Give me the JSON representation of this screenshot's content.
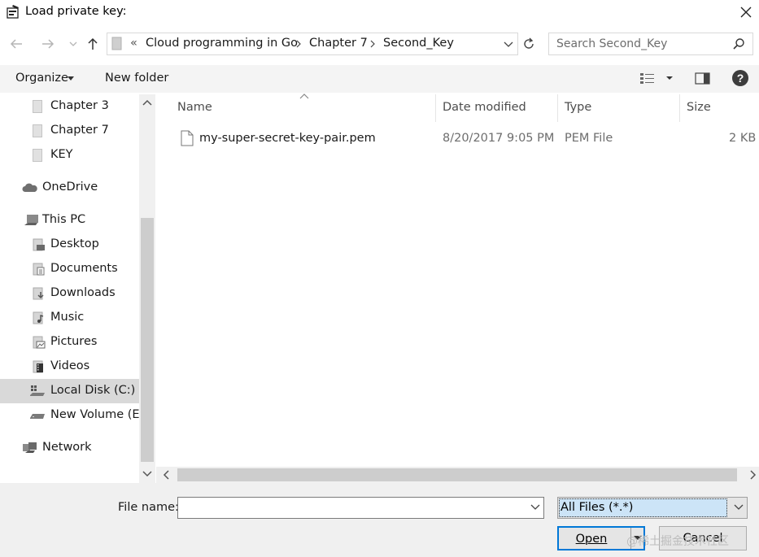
{
  "window": {
    "title": "Load private key:"
  },
  "address_bar": {
    "overflow": "«",
    "crumbs": [
      "Cloud programming in Go",
      "Chapter 7",
      "Second_Key"
    ]
  },
  "search": {
    "placeholder": "Search Second_Key"
  },
  "toolbar": {
    "organize": "Organize",
    "new_folder": "New folder"
  },
  "nav": {
    "items": [
      {
        "label": "Chapter 3",
        "icon": "folder-icon"
      },
      {
        "label": "Chapter 7",
        "icon": "folder-icon"
      },
      {
        "label": "KEY",
        "icon": "folder-icon"
      },
      {
        "label": "OneDrive",
        "icon": "cloud-icon"
      },
      {
        "label": "This PC",
        "icon": "computer-icon"
      },
      {
        "label": "Desktop",
        "icon": "desktop-icon"
      },
      {
        "label": "Documents",
        "icon": "documents-icon"
      },
      {
        "label": "Downloads",
        "icon": "downloads-icon"
      },
      {
        "label": "Music",
        "icon": "music-icon"
      },
      {
        "label": "Pictures",
        "icon": "pictures-icon"
      },
      {
        "label": "Videos",
        "icon": "videos-icon"
      },
      {
        "label": "Local Disk (C:)",
        "icon": "local-disk-icon",
        "selected": true
      },
      {
        "label": "New Volume (E:)",
        "icon": "drive-icon"
      },
      {
        "label": "Network",
        "icon": "network-icon"
      }
    ]
  },
  "columns": [
    "Name",
    "Date modified",
    "Type",
    "Size"
  ],
  "files": [
    {
      "name": "my-super-secret-key-pair.pem",
      "date": "8/20/2017 9:05 PM",
      "type": "PEM File",
      "size": "2 KB"
    }
  ],
  "bottom": {
    "file_name_label": "File name:",
    "file_name_value": "",
    "filter": "All Files (*.*)",
    "open": "Open",
    "cancel": "Cancel"
  },
  "watermark": "@稀土掘金技术社区",
  "colors": {
    "selection": "#d9d9d9",
    "accent": "#0078d7",
    "help": "#1e5aa8"
  }
}
